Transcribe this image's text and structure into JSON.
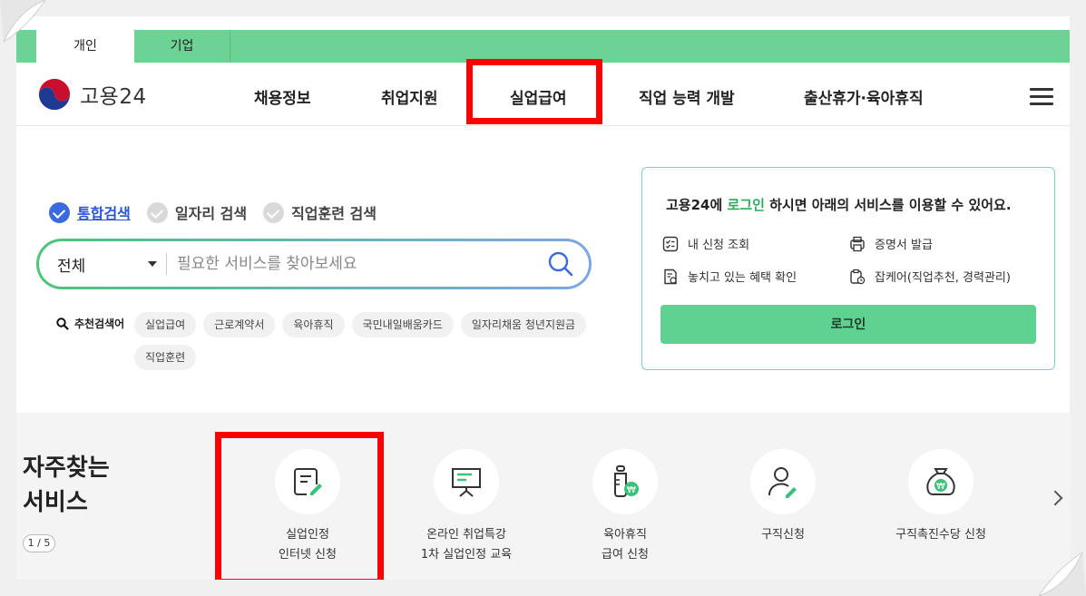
{
  "tabs": {
    "personal": "개인",
    "business": "기업"
  },
  "header": {
    "logo_text": "고용24",
    "nav": [
      "채용정보",
      "취업지원",
      "실업급여",
      "직업 능력 개발",
      "출산휴가·육아휴직"
    ]
  },
  "search": {
    "tabs": [
      "통합검색",
      "일자리 검색",
      "직업훈련 검색"
    ],
    "select_value": "전체",
    "placeholder": "필요한 서비스를 찾아보세요",
    "recommend_label": "추천검색어",
    "chips": [
      "실업급여",
      "근로계약서",
      "육아휴직",
      "국민내일배움카드",
      "일자리채움 청년지원금",
      "직업훈련"
    ]
  },
  "login_card": {
    "title_pre": "고용24에 ",
    "title_hl": "로그인",
    "title_post": " 하시면 아래의 서비스를 이용할 수 있어요.",
    "services": [
      "내 신청 조회",
      "증명서 발급",
      "놓치고 있는 혜택 확인",
      "잡케어(직업추천, 경력관리)"
    ],
    "button": "로그인"
  },
  "freq": {
    "title_line1": "자주찾는",
    "title_line2": "서비스",
    "pager": "1 / 5",
    "items": [
      {
        "line1": "실업인정",
        "line2": "인터넷 신청",
        "icon": "document-pen-icon"
      },
      {
        "line1": "온라인 취업특강",
        "line2": "1차 실업인정 교육",
        "icon": "presentation-board-icon"
      },
      {
        "line1": "육아휴직",
        "line2": "급여 신청",
        "icon": "baby-bottle-won-icon"
      },
      {
        "line1": "구직신청",
        "line2": "",
        "icon": "person-pen-icon"
      },
      {
        "line1": "구직촉진수당 신청",
        "line2": "",
        "icon": "money-bag-won-icon"
      }
    ]
  },
  "colors": {
    "brand_green": "#6cd395",
    "highlight_red": "#ff0000",
    "login_btn": "#5fd190",
    "search_blue": "#3b6ae0"
  }
}
